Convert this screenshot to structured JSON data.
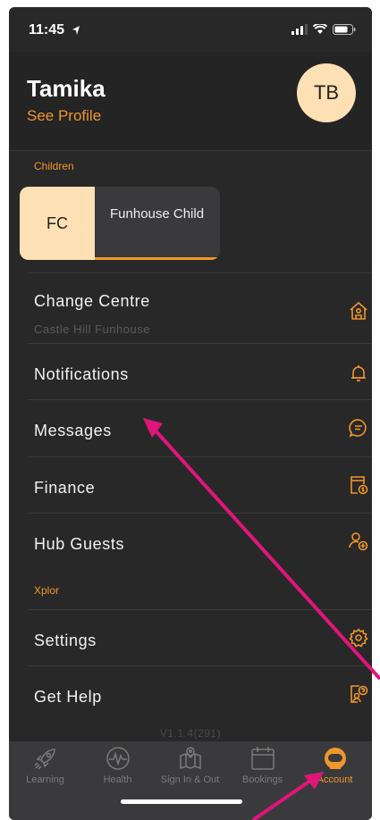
{
  "status_bar": {
    "time": "11:45"
  },
  "header": {
    "name": "Tamika",
    "see_profile": "See Profile",
    "avatar_initials": "TB"
  },
  "children": {
    "section_label": "Children",
    "items": [
      {
        "initials": "FC",
        "name": "Funhouse Child"
      }
    ]
  },
  "menu": [
    {
      "label": "Change Centre",
      "sublabel": "Castle Hill Funhouse",
      "icon": "house-icon"
    },
    {
      "label": "Notifications",
      "icon": "bell-icon"
    },
    {
      "label": "Messages",
      "icon": "chat-bubble-icon"
    },
    {
      "label": "Finance",
      "icon": "invoice-dollar-icon"
    },
    {
      "label": "Hub Guests",
      "icon": "person-add-icon"
    }
  ],
  "xplor": {
    "section_label": "Xplor",
    "items": [
      {
        "label": "Settings",
        "icon": "gear-icon"
      },
      {
        "label": "Get Help",
        "icon": "help-document-icon"
      }
    ]
  },
  "version": "V1.1.4(291)",
  "tabs": [
    {
      "label": "Learning",
      "icon": "rocket-icon",
      "active": false
    },
    {
      "label": "Health",
      "icon": "heartbeat-icon",
      "active": false
    },
    {
      "label": "Sign In & Out",
      "icon": "map-icon",
      "active": false
    },
    {
      "label": "Bookings",
      "icon": "calendar-icon",
      "active": false
    },
    {
      "label": "Account",
      "icon": "astronaut-helmet-icon",
      "active": true
    }
  ],
  "colors": {
    "accent": "#f0962c",
    "background": "#282828",
    "tabbar": "#3a3a3c",
    "avatar": "#fde0b4",
    "annotation_arrow": "#e0157a"
  }
}
